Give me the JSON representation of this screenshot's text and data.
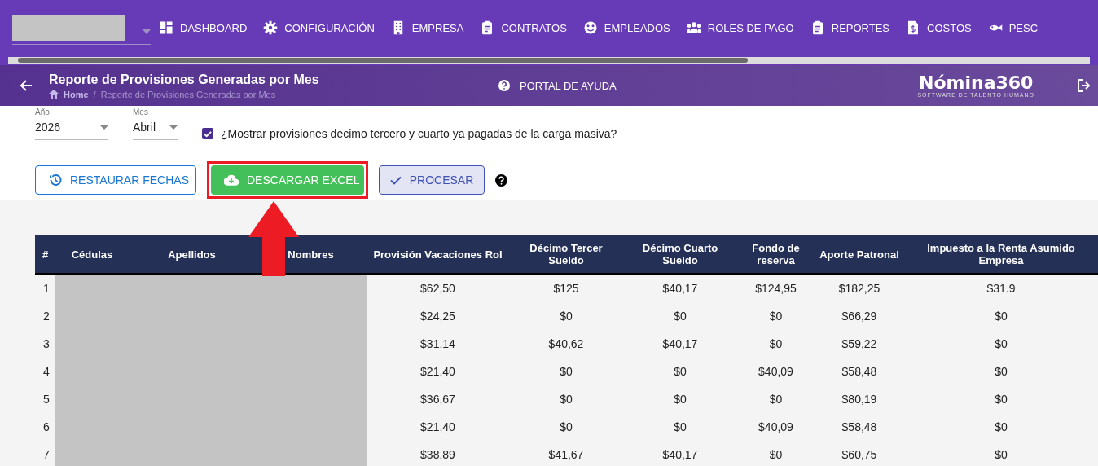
{
  "nav": {
    "items": [
      {
        "label": "DASHBOARD"
      },
      {
        "label": "CONFIGURACIÓN"
      },
      {
        "label": "EMPRESA"
      },
      {
        "label": "CONTRATOS"
      },
      {
        "label": "EMPLEADOS"
      },
      {
        "label": "ROLES DE PAGO"
      },
      {
        "label": "REPORTES"
      },
      {
        "label": "COSTOS"
      },
      {
        "label": "PESC"
      }
    ]
  },
  "header": {
    "title": "Reporte de Provisiones Generadas por Mes",
    "breadcrumb": {
      "home": "Home",
      "separator": "/",
      "current": "Reporte de Provisiones Generadas por Mes"
    },
    "help_label": "PORTAL DE AYUDA",
    "logo": {
      "name": "Nómina360",
      "tagline": "SOFTWARE DE TALENTO HUMANO"
    }
  },
  "filters": {
    "year": {
      "label": "Año",
      "value": "2026"
    },
    "month": {
      "label": "Mes",
      "value": "Abril"
    },
    "mass_load_checkbox": {
      "label": "¿Mostrar provisiones decimo tercero y cuarto ya pagadas de la carga masiva?",
      "checked": true
    }
  },
  "buttons": [
    {
      "label": "RESTAURAR FECHAS",
      "kind": "outline"
    },
    {
      "label": "DESCARGAR EXCEL",
      "kind": "success"
    },
    {
      "label": "PROCESAR",
      "kind": "soft"
    }
  ],
  "table": {
    "columns": [
      "#",
      "Cédulas",
      "Apellidos",
      "Nombres",
      "Provisión Vacaciones Rol",
      "Décimo Tercer Sueldo",
      "Décimo Cuarto Sueldo",
      "Fondo de reserva",
      "Aporte Patronal",
      "Impuesto a la Renta Asumido Empresa"
    ],
    "rows": [
      {
        "index": "1",
        "values": [
          "$62,50",
          "$125",
          "$40,17",
          "$124,95",
          "$182,25",
          "$31.9"
        ]
      },
      {
        "index": "2",
        "values": [
          "$24,25",
          "$0",
          "$0",
          "$0",
          "$66,29",
          "$0"
        ]
      },
      {
        "index": "3",
        "values": [
          "$31,14",
          "$40,62",
          "$40,17",
          "$0",
          "$59,22",
          "$0"
        ]
      },
      {
        "index": "4",
        "values": [
          "$21,40",
          "$0",
          "$0",
          "$40,09",
          "$58,48",
          "$0"
        ]
      },
      {
        "index": "5",
        "values": [
          "$36,67",
          "$0",
          "$0",
          "$0",
          "$80,19",
          "$0"
        ]
      },
      {
        "index": "6",
        "values": [
          "$21,40",
          "$0",
          "$0",
          "$40,09",
          "$58,48",
          "$0"
        ]
      },
      {
        "index": "7",
        "values": [
          "$38,89",
          "$41,67",
          "$40,17",
          "$0",
          "$60,75",
          "$0"
        ]
      }
    ]
  }
}
